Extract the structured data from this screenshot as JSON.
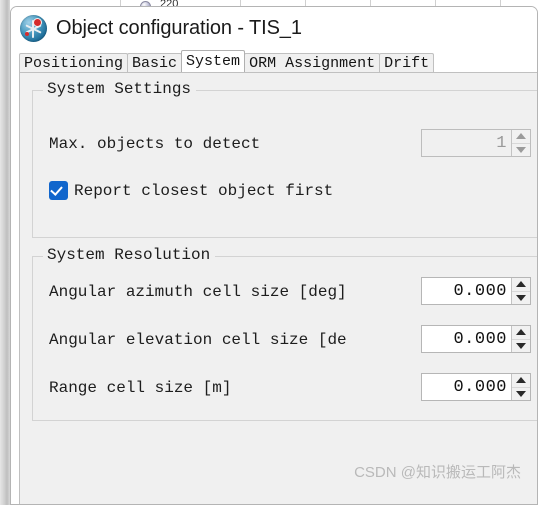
{
  "background_app": {
    "cell_value": "220",
    "row_icon": "circle-icon"
  },
  "window": {
    "title": "Object configuration - TIS_1",
    "icon_name": "robot-antenna-icon"
  },
  "tabs": [
    {
      "label": "Positioning",
      "selected": false
    },
    {
      "label": "Basic",
      "selected": false
    },
    {
      "label": "System",
      "selected": true
    },
    {
      "label": "ORM Assignment",
      "selected": false
    },
    {
      "label": "Drift",
      "selected": false
    }
  ],
  "system_settings": {
    "legend": "System Settings",
    "max_objects": {
      "label": "Max. objects to detect",
      "value": "1",
      "enabled": false
    },
    "report_closest": {
      "label": "Report closest object first",
      "checked": true
    }
  },
  "system_resolution": {
    "legend": "System Resolution",
    "fields": [
      {
        "label": "Angular azimuth cell size [deg]",
        "value": "0.000"
      },
      {
        "label": "Angular elevation cell size [de",
        "value": "0.000"
      },
      {
        "label": "Range cell size [m]",
        "value": "0.000"
      }
    ]
  },
  "watermark": {
    "text": "CSDN @知识搬运工阿杰"
  },
  "colors": {
    "accent_blue": "#1166cc",
    "dialog_bg": "#f0f0f0",
    "titlebar_bg": "#ffffff",
    "border": "#d3d3d3"
  }
}
